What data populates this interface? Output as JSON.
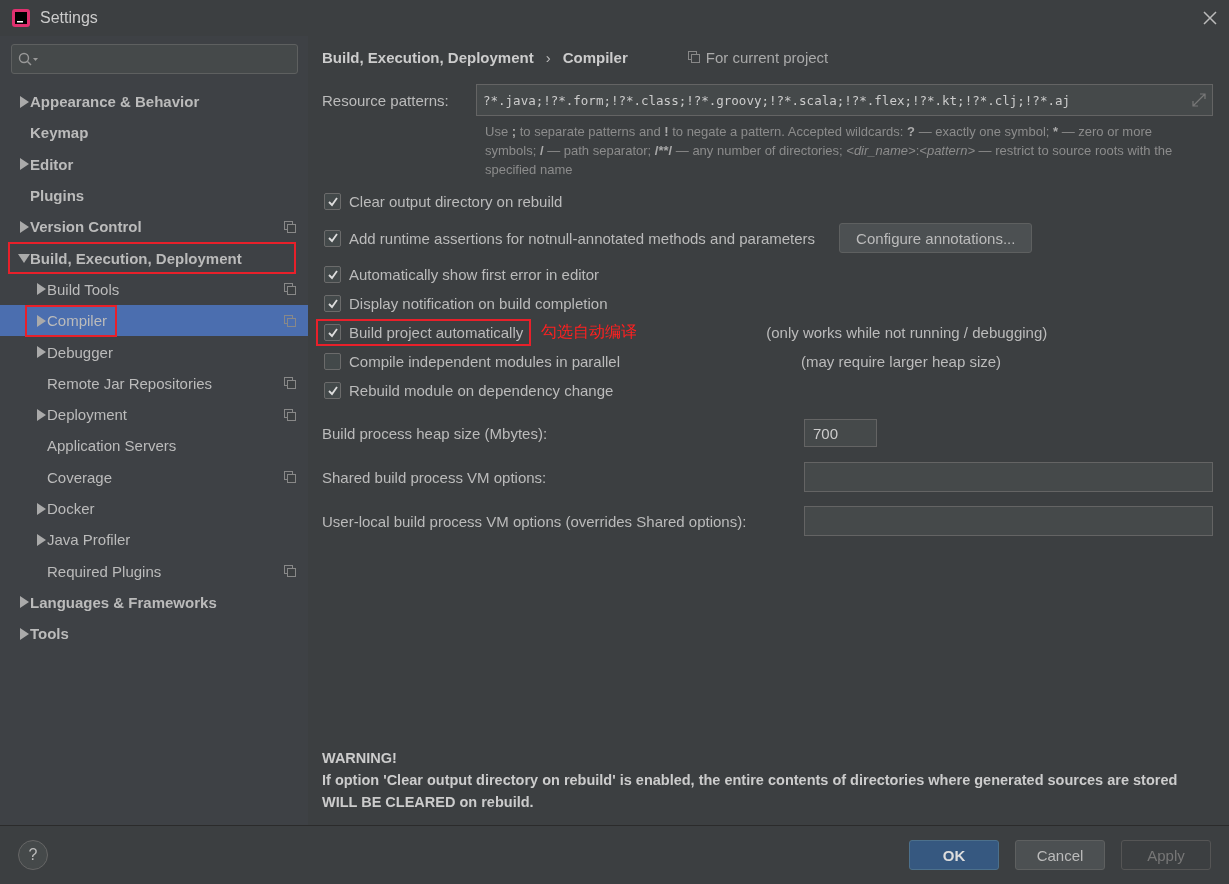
{
  "window": {
    "title": "Settings"
  },
  "sidebar": {
    "tree": [
      {
        "label": "Appearance & Behavior",
        "expandable": true,
        "expanded": false,
        "shared": false,
        "selected": false,
        "annotated": false
      },
      {
        "label": "Keymap",
        "expandable": false,
        "shared": false,
        "selected": false,
        "annotated": false
      },
      {
        "label": "Editor",
        "expandable": true,
        "expanded": false,
        "shared": false,
        "selected": false,
        "annotated": false
      },
      {
        "label": "Plugins",
        "expandable": false,
        "shared": false,
        "selected": false,
        "annotated": false
      },
      {
        "label": "Version Control",
        "expandable": true,
        "expanded": false,
        "shared": true,
        "selected": false,
        "annotated": false
      },
      {
        "label": "Build, Execution, Deployment",
        "expandable": true,
        "expanded": true,
        "shared": false,
        "selected": false,
        "annotated": true,
        "children": [
          {
            "label": "Build Tools",
            "expandable": true,
            "expanded": false,
            "shared": true,
            "selected": false,
            "annotated": false
          },
          {
            "label": "Compiler",
            "expandable": true,
            "expanded": false,
            "shared": true,
            "selected": true,
            "annotated": true
          },
          {
            "label": "Debugger",
            "expandable": true,
            "expanded": false,
            "shared": false,
            "selected": false,
            "annotated": false
          },
          {
            "label": "Remote Jar Repositories",
            "expandable": false,
            "shared": true,
            "selected": false,
            "annotated": false
          },
          {
            "label": "Deployment",
            "expandable": true,
            "expanded": false,
            "shared": true,
            "selected": false,
            "annotated": false
          },
          {
            "label": "Application Servers",
            "expandable": false,
            "shared": false,
            "selected": false,
            "annotated": false
          },
          {
            "label": "Coverage",
            "expandable": false,
            "shared": true,
            "selected": false,
            "annotated": false
          },
          {
            "label": "Docker",
            "expandable": true,
            "expanded": false,
            "shared": false,
            "selected": false,
            "annotated": false
          },
          {
            "label": "Java Profiler",
            "expandable": true,
            "expanded": false,
            "shared": false,
            "selected": false,
            "annotated": false
          },
          {
            "label": "Required Plugins",
            "expandable": false,
            "shared": true,
            "selected": false,
            "annotated": false
          }
        ]
      },
      {
        "label": "Languages & Frameworks",
        "expandable": true,
        "expanded": false,
        "shared": false,
        "selected": false,
        "annotated": false
      },
      {
        "label": "Tools",
        "expandable": true,
        "expanded": false,
        "shared": false,
        "selected": false,
        "annotated": false
      }
    ]
  },
  "breadcrumb": {
    "parent": "Build, Execution, Deployment",
    "separator": "›",
    "current": "Compiler",
    "scope": "For current project"
  },
  "resource_patterns": {
    "label": "Resource patterns:",
    "value": "?*.java;!?*.form;!?*.class;!?*.groovy;!?*.scala;!?*.flex;!?*.kt;!?*.clj;!?*.aj",
    "hint": [
      {
        "kind": "plain",
        "text": "Use "
      },
      {
        "kind": "bold",
        "text": ";"
      },
      {
        "kind": "plain",
        "text": " to separate patterns and "
      },
      {
        "kind": "bold",
        "text": "!"
      },
      {
        "kind": "plain",
        "text": " to negate a pattern. Accepted wildcards: "
      },
      {
        "kind": "bold",
        "text": "?"
      },
      {
        "kind": "plain",
        "text": " — exactly one symbol; "
      },
      {
        "kind": "bold",
        "text": "*"
      },
      {
        "kind": "plain",
        "text": " — zero or more symbols; "
      },
      {
        "kind": "bold",
        "text": "/"
      },
      {
        "kind": "plain",
        "text": " — path separator; "
      },
      {
        "kind": "bold",
        "text": "/**/"
      },
      {
        "kind": "plain",
        "text": " — any number of directories;  "
      },
      {
        "kind": "italic",
        "text": "<dir_name>"
      },
      {
        "kind": "plain",
        "text": ":"
      },
      {
        "kind": "italic",
        "text": "<pattern>"
      },
      {
        "kind": "plain",
        "text": " — restrict to source roots with the specified name"
      }
    ]
  },
  "options": [
    {
      "label": "Clear output directory on rebuild",
      "checked": true,
      "annotated": false
    },
    {
      "label": "Add runtime assertions for notnull-annotated methods and parameters",
      "checked": true,
      "annotated": false,
      "button": "Configure annotations..."
    },
    {
      "label": "Automatically show first error in editor",
      "checked": true,
      "annotated": false
    },
    {
      "label": "Display notification on build completion",
      "checked": true,
      "annotated": false
    },
    {
      "label": "Build project automatically",
      "checked": true,
      "annotated": true,
      "annotation": "勾选自动编译",
      "note": "(only works while not running / debugging)"
    },
    {
      "label": "Compile independent modules in parallel",
      "checked": false,
      "annotated": false,
      "note": "(may require larger heap size)"
    },
    {
      "label": "Rebuild module on dependency change",
      "checked": true,
      "annotated": false
    }
  ],
  "fields": [
    {
      "label": "Build process heap size (Mbytes):",
      "value": "700",
      "kind": "short"
    },
    {
      "label": "Shared build process VM options:",
      "kind": "wide"
    },
    {
      "label": "User-local build process VM options (overrides Shared options):",
      "kind": "wide"
    }
  ],
  "warning": {
    "title": "WARNING!",
    "text": "If option 'Clear output directory on rebuild' is enabled, the entire contents of directories where generated sources are stored WILL BE CLEARED on rebuild."
  },
  "help": "?",
  "buttons": [
    {
      "label": "OK",
      "kind": "default",
      "disabled": false
    },
    {
      "label": "Cancel",
      "kind": "normal",
      "disabled": false
    },
    {
      "label": "Apply",
      "kind": "normal",
      "disabled": true
    }
  ]
}
